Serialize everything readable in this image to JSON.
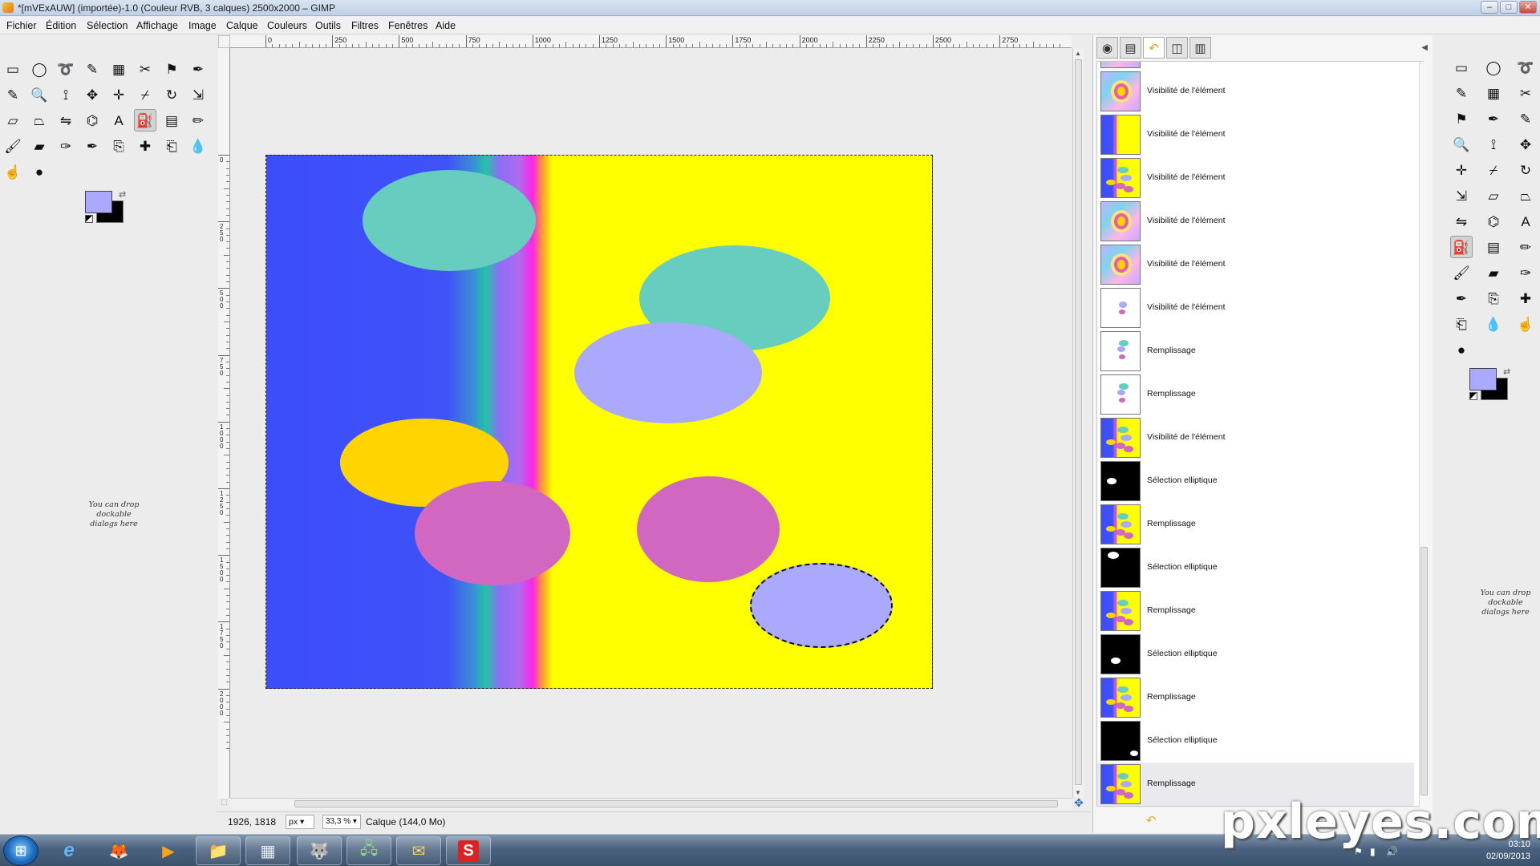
{
  "window": {
    "title": "*[mVExAUW] (importée)-1.0 (Couleur RVB, 3 calques) 2500x2000 – GIMP"
  },
  "window_buttons": {
    "minimize": "–",
    "maximize": "□",
    "close": "✕"
  },
  "menu": {
    "items": [
      "Fichier",
      "Édition",
      "Sélection",
      "Affichage",
      "Image",
      "Calque",
      "Couleurs",
      "Outils",
      "Filtres",
      "Fenêtres",
      "Aide"
    ]
  },
  "left_toolbox": {
    "tools": [
      {
        "icon": "rectangle-select-icon",
        "glyph": "▭"
      },
      {
        "icon": "ellipse-select-icon",
        "glyph": "◯"
      },
      {
        "icon": "free-select-icon",
        "glyph": "➰"
      },
      {
        "icon": "fuzzy-select-icon",
        "glyph": "✎"
      },
      {
        "icon": "select-by-color-icon",
        "glyph": "▦"
      },
      {
        "icon": "scissors-select-icon",
        "glyph": "✂"
      },
      {
        "icon": "foreground-select-icon",
        "glyph": "⚑"
      },
      {
        "icon": "paths-icon",
        "glyph": "✒"
      },
      {
        "icon": "color-picker-icon",
        "glyph": "✎"
      },
      {
        "icon": "zoom-icon",
        "glyph": "🔍"
      },
      {
        "icon": "measure-icon",
        "glyph": "⟟"
      },
      {
        "icon": "move-icon",
        "glyph": "✥"
      },
      {
        "icon": "align-icon",
        "glyph": "✛"
      },
      {
        "icon": "crop-icon",
        "glyph": "⌿"
      },
      {
        "icon": "rotate-icon",
        "glyph": "↻"
      },
      {
        "icon": "scale-icon",
        "glyph": "⇲"
      },
      {
        "icon": "shear-icon",
        "glyph": "▱"
      },
      {
        "icon": "perspective-icon",
        "glyph": "⏢"
      },
      {
        "icon": "flip-icon",
        "glyph": "⇋"
      },
      {
        "icon": "cage-icon",
        "glyph": "⌬"
      },
      {
        "icon": "text-icon",
        "glyph": "A"
      },
      {
        "icon": "bucket-fill-icon",
        "glyph": "⛽"
      },
      {
        "icon": "blend-icon",
        "glyph": "▤"
      },
      {
        "icon": "pencil-icon",
        "glyph": "✏"
      },
      {
        "icon": "paintbrush-icon",
        "glyph": "🖌"
      },
      {
        "icon": "eraser-icon",
        "glyph": "▰"
      },
      {
        "icon": "airbrush-icon",
        "glyph": "✑"
      },
      {
        "icon": "ink-icon",
        "glyph": "✒"
      },
      {
        "icon": "clone-icon",
        "glyph": "⎘"
      },
      {
        "icon": "heal-icon",
        "glyph": "✚"
      },
      {
        "icon": "perspective-clone-icon",
        "glyph": "⎗"
      },
      {
        "icon": "blur-icon",
        "glyph": "💧"
      },
      {
        "icon": "smudge-icon",
        "glyph": "☝"
      },
      {
        "icon": "dodge-burn-icon",
        "glyph": "●"
      }
    ],
    "fg_color": "#aaa9fd",
    "bg_color": "#000000"
  },
  "left_dropzone": "You can drop dockable dialogs here",
  "rulers": {
    "h_labels": [
      "0",
      "250",
      "500",
      "750",
      "1000",
      "1250",
      "1500",
      "1750",
      "2000",
      "2250",
      "2500",
      "2750"
    ],
    "v_labels": [
      "0",
      "250",
      "500",
      "750",
      "1000",
      "1250",
      "1500",
      "1750",
      "2000"
    ]
  },
  "canvas": {
    "shapes": [
      {
        "name": "teal-ellipse-top",
        "color": "#66cdbf"
      },
      {
        "name": "teal-ellipse-right",
        "color": "#66cdbf"
      },
      {
        "name": "lavender-ellipse-mid",
        "color": "#aaa9fd"
      },
      {
        "name": "orange-ellipse",
        "color": "#ffd400"
      },
      {
        "name": "pink-ellipse-left",
        "color": "#d167c0"
      },
      {
        "name": "pink-ellipse-right",
        "color": "#d167c0"
      },
      {
        "name": "lavender-ellipse-selected",
        "color": "#aaa9fd"
      }
    ],
    "background_colors": [
      "#3c4dfb",
      "#25c2a8",
      "#ff23ea",
      "#ffff00"
    ]
  },
  "statusbar": {
    "coords": "1926, 1818",
    "unit": "px",
    "zoom": "33,3 %",
    "layer_info": "Calque (144,0 Mo)"
  },
  "dock": {
    "tabs": [
      {
        "icon": "tool-options-icon",
        "glyph": "◉"
      },
      {
        "icon": "layers-icon",
        "glyph": "▤"
      },
      {
        "icon": "undo-history-icon",
        "glyph": "↶"
      },
      {
        "icon": "channels-icon",
        "glyph": "◫"
      },
      {
        "icon": "paths-tab-icon",
        "glyph": "▥"
      }
    ],
    "undo_items": [
      {
        "label": "Visibilité de l'élément",
        "thumb": "flower"
      },
      {
        "label": "Visibilité de l'élément",
        "thumb": "blueyellow"
      },
      {
        "label": "Visibilité de l'élément",
        "thumb": "blueyellow-ellipses"
      },
      {
        "label": "Visibilité de l'élément",
        "thumb": "flower"
      },
      {
        "label": "Visibilité de l'élément",
        "thumb": "flower"
      },
      {
        "label": "Visibilité de l'élément",
        "thumb": "white-ellipses"
      },
      {
        "label": "Remplissage",
        "thumb": "white-ellipses2"
      },
      {
        "label": "Remplissage",
        "thumb": "white-ellipses2"
      },
      {
        "label": "Visibilité de l'élément",
        "thumb": "blueyellow-ellipses"
      },
      {
        "label": "Sélection elliptique",
        "thumb": "black-left"
      },
      {
        "label": "Remplissage",
        "thumb": "blueyellow-ellipses"
      },
      {
        "label": "Sélection elliptique",
        "thumb": "black-topleft"
      },
      {
        "label": "Remplissage",
        "thumb": "blueyellow-ellipses"
      },
      {
        "label": "Sélection elliptique",
        "thumb": "black-bottomleft"
      },
      {
        "label": "Remplissage",
        "thumb": "blueyellow-ellipses"
      },
      {
        "label": "Sélection elliptique",
        "thumb": "black-bottomright"
      },
      {
        "label": "Remplissage",
        "thumb": "blueyellow-ellipses"
      }
    ]
  },
  "right_toolbox": {
    "tools": [
      {
        "icon": "rectangle-select-icon",
        "glyph": "▭"
      },
      {
        "icon": "ellipse-select-icon",
        "glyph": "◯"
      },
      {
        "icon": "free-select-icon",
        "glyph": "➰"
      },
      {
        "icon": "fuzzy-select-icon",
        "glyph": "✎"
      },
      {
        "icon": "select-by-color-icon",
        "glyph": "▦"
      },
      {
        "icon": "scissors-select-icon",
        "glyph": "✂"
      },
      {
        "icon": "foreground-select-icon",
        "glyph": "⚑"
      },
      {
        "icon": "paths-icon",
        "glyph": "✒"
      },
      {
        "icon": "color-picker-icon",
        "glyph": "✎"
      },
      {
        "icon": "zoom-icon",
        "glyph": "🔍"
      },
      {
        "icon": "measure-icon",
        "glyph": "⟟"
      },
      {
        "icon": "move-icon",
        "glyph": "✥"
      },
      {
        "icon": "align-icon",
        "glyph": "✛"
      },
      {
        "icon": "crop-icon",
        "glyph": "⌿"
      },
      {
        "icon": "rotate-icon",
        "glyph": "↻"
      },
      {
        "icon": "scale-icon",
        "glyph": "⇲"
      },
      {
        "icon": "shear-icon",
        "glyph": "▱"
      },
      {
        "icon": "perspective-icon",
        "glyph": "⏢"
      },
      {
        "icon": "flip-icon",
        "glyph": "⇋"
      },
      {
        "icon": "cage-icon",
        "glyph": "⌬"
      },
      {
        "icon": "text-icon",
        "glyph": "A"
      },
      {
        "icon": "bucket-fill-icon",
        "glyph": "⛽"
      },
      {
        "icon": "blend-icon",
        "glyph": "▤"
      },
      {
        "icon": "pencil-icon",
        "glyph": "✏"
      },
      {
        "icon": "paintbrush-icon",
        "glyph": "🖌"
      },
      {
        "icon": "eraser-icon",
        "glyph": "▰"
      },
      {
        "icon": "airbrush-icon",
        "glyph": "✑"
      },
      {
        "icon": "ink-icon",
        "glyph": "✒"
      },
      {
        "icon": "clone-icon",
        "glyph": "⎘"
      },
      {
        "icon": "heal-icon",
        "glyph": "✚"
      },
      {
        "icon": "perspective-clone-icon",
        "glyph": "⎗"
      },
      {
        "icon": "blur-icon",
        "glyph": "💧"
      },
      {
        "icon": "smudge-icon",
        "glyph": "☝"
      },
      {
        "icon": "dodge-burn-icon",
        "glyph": "●"
      }
    ]
  },
  "right_dropzone": "You can drop dockable dialogs here",
  "taskbar": {
    "start_icon": "windows-start-icon",
    "apps": [
      {
        "icon": "internet-explorer-icon",
        "glyph": "e"
      },
      {
        "icon": "firefox-icon",
        "glyph": "🦊"
      },
      {
        "icon": "media-player-icon",
        "glyph": "▶"
      },
      {
        "icon": "explorer-folder-icon",
        "glyph": "📁"
      },
      {
        "icon": "calculator-icon",
        "glyph": "▦"
      },
      {
        "icon": "gimp-icon",
        "glyph": "🐺"
      },
      {
        "icon": "network-app-icon",
        "glyph": "🖧"
      },
      {
        "icon": "mail-app-icon",
        "glyph": "✉"
      },
      {
        "icon": "swf-app-icon",
        "glyph": "S"
      }
    ],
    "time": "03:10",
    "date": "02/09/2013"
  },
  "watermark": "pxleyes.com"
}
